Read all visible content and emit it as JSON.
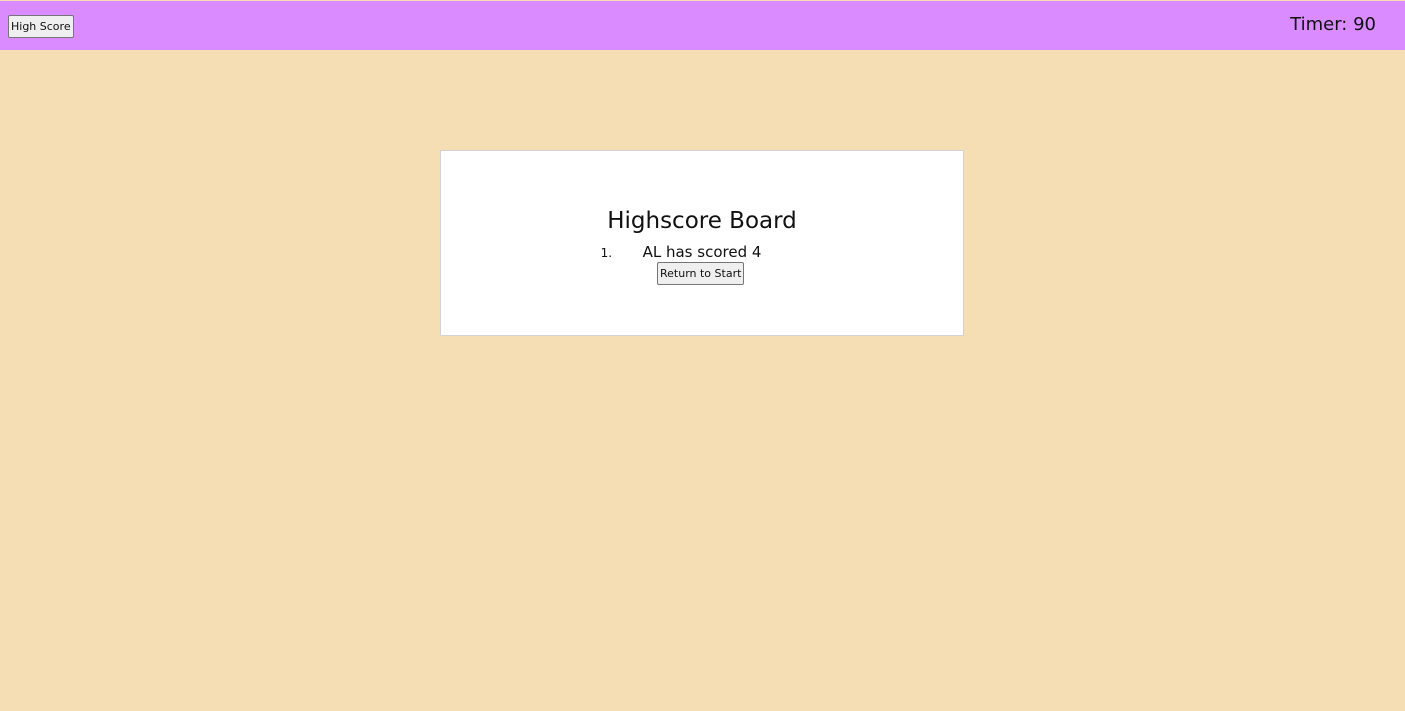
{
  "header": {
    "high_score_label": "High Score",
    "timer_text": "Timer: 90"
  },
  "board": {
    "title": "Highscore Board",
    "scores": [
      {
        "rank": "1.",
        "text": "AL has scored 4"
      }
    ],
    "return_label": "Return to Start"
  },
  "colors": {
    "header_bg": "#d98bff",
    "page_bg": "#f5deb4",
    "card_bg": "#ffffff"
  }
}
